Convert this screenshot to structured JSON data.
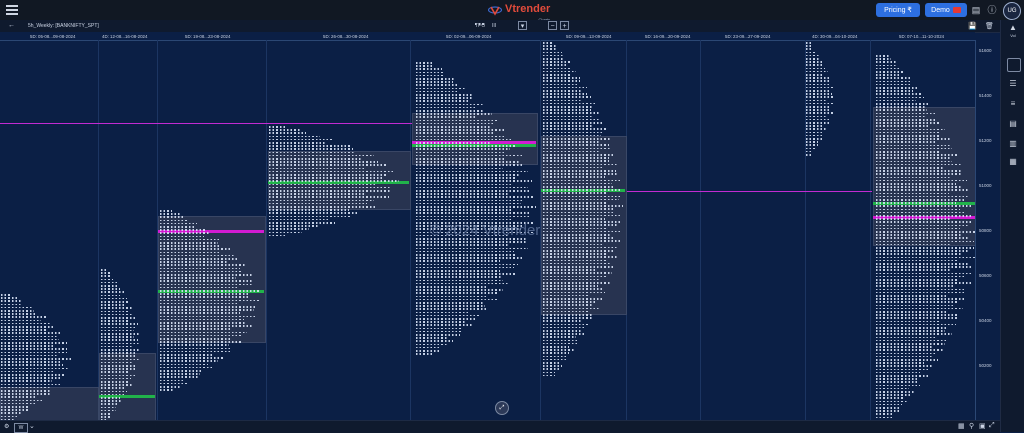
{
  "header": {
    "brand": "Vtrender",
    "brand_sub": "Charts",
    "pricing_label": "Pricing ₹",
    "demo_label": "Demo",
    "avatar_initials": "UG"
  },
  "toolbar": {
    "symbol": "5h_Weekly: [BANKNIFTY_SPT]",
    "tpo_label": "TPO",
    "timeframe": "III",
    "zoom_out": "−",
    "zoom_in": "+"
  },
  "sessions": [
    "5D: 05-08...09-08-2024",
    "4D: 12-08...16-08-2024",
    "5D: 19-08...23-08-2024",
    "5D: 26-08...30-08-2024",
    "5D: 02-09...06-09-2024",
    "5D: 09-09...13-09-2024",
    "5D: 16-09...20-09-2024",
    "5D: 23-09...27-09-2024",
    "4D: 30-09...04-10-2024",
    "5D: 07-10...11-10-2024"
  ],
  "price_axis": [
    "51600",
    "51400",
    "51200",
    "51000",
    "50800",
    "50600",
    "50400",
    "50200"
  ],
  "sidebar": {
    "label": "Vol"
  },
  "watermark": "© 2024 Vtrender",
  "colors": {
    "background": "#0b1f45",
    "value_area": "#2a3552",
    "poc": "#21b34a",
    "single_print": "#d21bd2",
    "accent_button": "#2d6fe0"
  }
}
